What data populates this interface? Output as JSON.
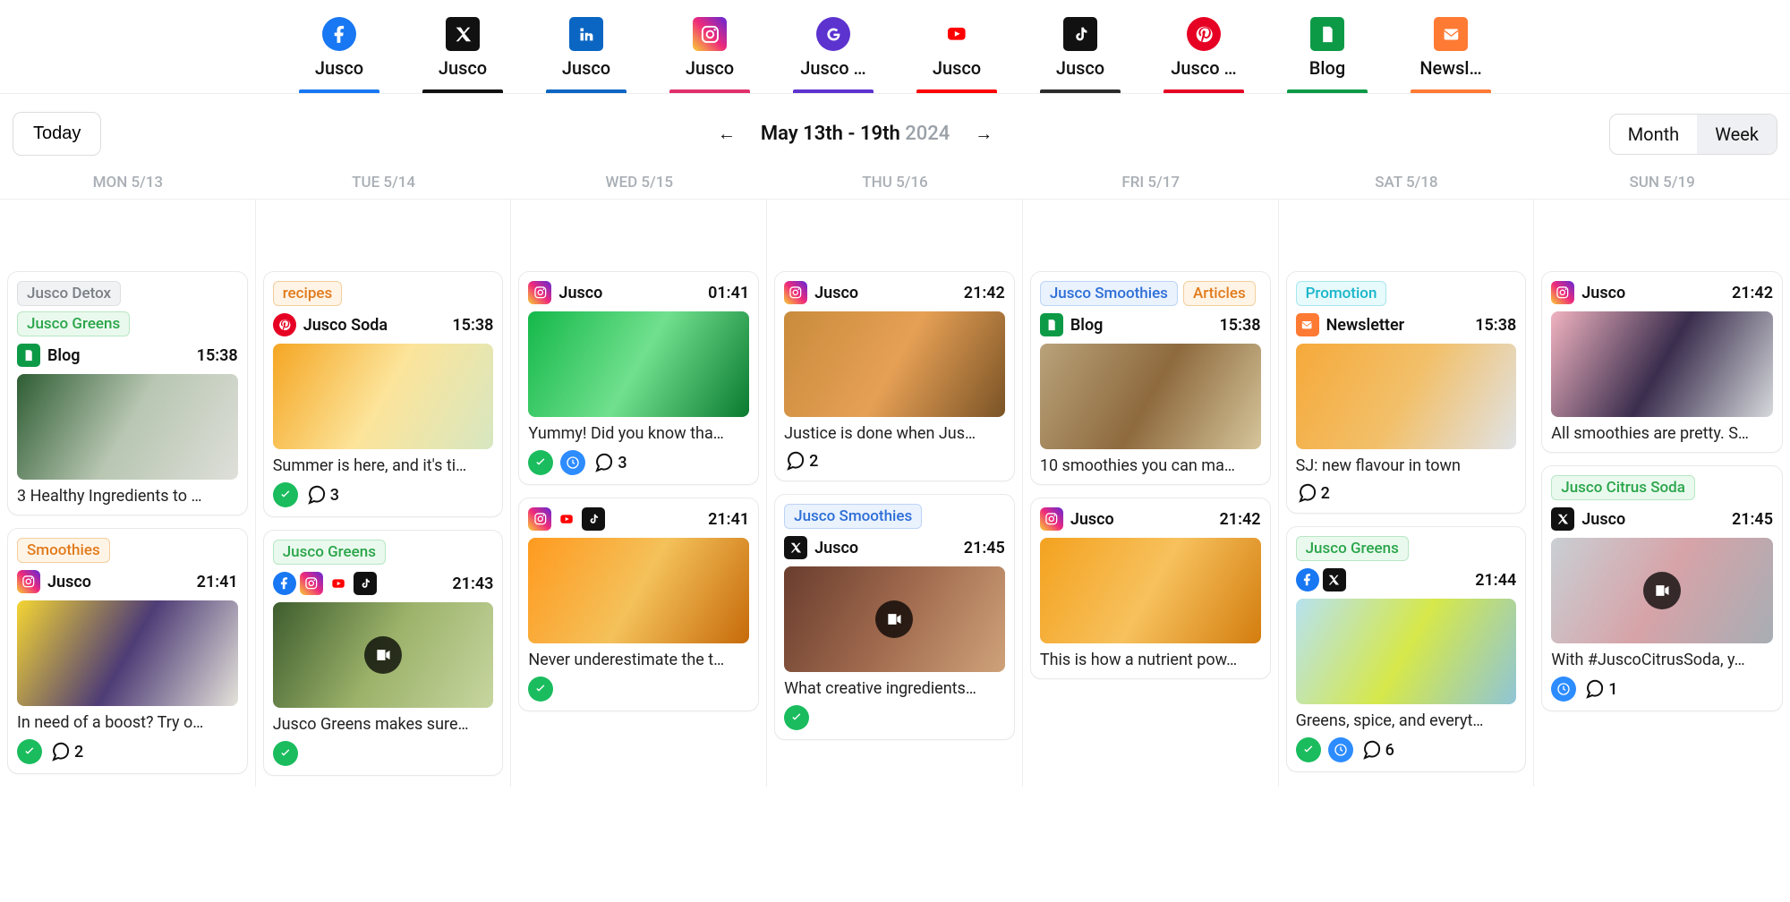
{
  "accounts": [
    {
      "platform": "facebook",
      "label": "Jusco",
      "color": "#1877f2"
    },
    {
      "platform": "x",
      "label": "Jusco",
      "color": "#111111"
    },
    {
      "platform": "linkedin",
      "label": "Jusco",
      "color": "#0a66c2"
    },
    {
      "platform": "instagram",
      "label": "Jusco",
      "color": "#e1306c"
    },
    {
      "platform": "google",
      "label": "Jusco …",
      "color": "#5c33cf"
    },
    {
      "platform": "youtube",
      "label": "Jusco",
      "color": "#ff0000"
    },
    {
      "platform": "tiktok",
      "label": "Jusco",
      "color": "#2c2c2c"
    },
    {
      "platform": "pinterest",
      "label": "Jusco …",
      "color": "#e60023"
    },
    {
      "platform": "blog",
      "label": "Blog",
      "color": "#0d9a47"
    },
    {
      "platform": "newsletter",
      "label": "Newsl…",
      "color": "#ff7a33"
    }
  ],
  "controls": {
    "today": "Today",
    "range_main": "May 13th - 19th",
    "range_year": "2024",
    "month": "Month",
    "week": "Week"
  },
  "days": [
    {
      "label": "MON 5/13"
    },
    {
      "label": "TUE 5/14"
    },
    {
      "label": "WED 5/15"
    },
    {
      "label": "THU 5/16"
    },
    {
      "label": "FRI 5/17"
    },
    {
      "label": "SAT 5/18"
    },
    {
      "label": "SUN 5/19"
    }
  ],
  "columns": [
    [
      {
        "tags": [
          {
            "text": "Jusco Detox",
            "fg": "#7a7f85",
            "bg": "#f1f2f4",
            "bd": "#dcdfe3"
          },
          {
            "text": "Jusco Greens",
            "fg": "#2aa54a",
            "bg": "#eaf9ee",
            "bd": "#b7e7c3"
          }
        ],
        "platforms": [
          "blog"
        ],
        "channel": "Blog",
        "time": "15:38",
        "thumb": {
          "colors": [
            "#2e5d33",
            "#b8c6b2",
            "#dedfd9"
          ],
          "video": false
        },
        "caption": "3 Healthy Ingredients to …",
        "status": null,
        "clock": false,
        "comments": null
      },
      {
        "tags": [
          {
            "text": "Smoothies",
            "fg": "#e07b1c",
            "bg": "#fff4e6",
            "bd": "#f2cf9e"
          }
        ],
        "platforms": [
          "instagram"
        ],
        "channel": "Jusco",
        "time": "21:41",
        "thumb": {
          "colors": [
            "#f4d533",
            "#4e3c76",
            "#e4e2da"
          ],
          "video": false
        },
        "caption": "In need of a boost? Try o…",
        "status": "green",
        "clock": false,
        "comments": 2
      }
    ],
    [
      {
        "tags": [
          {
            "text": "recipes",
            "fg": "#e07b1c",
            "bg": "#fff4e6",
            "bd": "#f2cf9e"
          }
        ],
        "platforms": [
          "pinterest"
        ],
        "channel": "Jusco Soda",
        "time": "15:38",
        "thumb": {
          "colors": [
            "#f5a623",
            "#fce49a",
            "#d7e7c1"
          ],
          "video": false
        },
        "caption": "Summer is here, and it's ti…",
        "status": "green",
        "clock": false,
        "comments": 3
      },
      {
        "tags": [
          {
            "text": "Jusco Greens",
            "fg": "#2aa54a",
            "bg": "#eaf9ee",
            "bd": "#b7e7c3"
          }
        ],
        "platforms": [
          "facebook",
          "instagram",
          "youtube",
          "tiktok"
        ],
        "channel": "",
        "time": "21:43",
        "thumb": {
          "colors": [
            "#3e5d2e",
            "#9cb26a",
            "#c7d6a0"
          ],
          "video": true
        },
        "caption": "Jusco Greens makes sure…",
        "status": "green",
        "clock": false,
        "comments": null
      }
    ],
    [
      {
        "tags": [],
        "platforms": [
          "instagram"
        ],
        "channel": "Jusco",
        "time": "01:41",
        "thumb": {
          "colors": [
            "#14b84a",
            "#71e08e",
            "#0a7a30"
          ],
          "video": false
        },
        "caption": "Yummy! Did you know tha…",
        "status": "green",
        "clock": true,
        "comments": 3
      },
      {
        "tags": [],
        "platforms": [
          "instagram",
          "youtube",
          "tiktok"
        ],
        "channel": "",
        "time": "21:41",
        "thumb": {
          "colors": [
            "#ff9a1f",
            "#f4c15a",
            "#c66a0a"
          ],
          "video": false
        },
        "caption": "Never underestimate the t…",
        "status": "green",
        "clock": false,
        "comments": null
      }
    ],
    [
      {
        "tags": [],
        "platforms": [
          "instagram"
        ],
        "channel": "Jusco",
        "time": "21:42",
        "thumb": {
          "colors": [
            "#c98b3c",
            "#e6a055",
            "#7a5326"
          ],
          "video": false
        },
        "caption": "Justice is done when Jus…",
        "status": null,
        "clock": false,
        "comments": 2
      },
      {
        "tags": [
          {
            "text": "Jusco Smoothies",
            "fg": "#2d6ed6",
            "bg": "#eaf2fe",
            "bd": "#bcd4f6"
          }
        ],
        "platforms": [
          "x"
        ],
        "channel": "Jusco",
        "time": "21:45",
        "thumb": {
          "colors": [
            "#6a3d2e",
            "#a06a4e",
            "#cfa27a"
          ],
          "video": true
        },
        "caption": "What creative ingredients…",
        "status": "green",
        "clock": false,
        "comments": null
      }
    ],
    [
      {
        "tags": [
          {
            "text": "Jusco Smoothies",
            "fg": "#2d6ed6",
            "bg": "#eaf2fe",
            "bd": "#bcd4f6"
          },
          {
            "text": "Articles",
            "fg": "#e07b1c",
            "bg": "#fff4e6",
            "bd": "#f2cf9e"
          }
        ],
        "platforms": [
          "blog"
        ],
        "channel": "Blog",
        "time": "15:38",
        "thumb": {
          "colors": [
            "#b9a27a",
            "#8e6a3e",
            "#d6c59b"
          ],
          "video": false
        },
        "caption": "10 smoothies you can ma…",
        "status": null,
        "clock": false,
        "comments": null
      },
      {
        "tags": [],
        "platforms": [
          "instagram"
        ],
        "channel": "Jusco",
        "time": "21:42",
        "thumb": {
          "colors": [
            "#f4a21f",
            "#f7c15d",
            "#d37d0e"
          ],
          "video": false
        },
        "caption": "This is how a nutrient pow…",
        "status": null,
        "clock": false,
        "comments": null
      }
    ],
    [
      {
        "tags": [
          {
            "text": "Promotion",
            "fg": "#18b6c9",
            "bg": "#e7fafc",
            "bd": "#a8e7ef"
          }
        ],
        "platforms": [
          "newsletter"
        ],
        "channel": "Newsletter",
        "time": "15:38",
        "thumb": {
          "colors": [
            "#f6a93a",
            "#f2c06a",
            "#e0e3e6"
          ],
          "video": false
        },
        "caption": "SJ: new flavour in town",
        "status": null,
        "clock": false,
        "comments": 2
      },
      {
        "tags": [
          {
            "text": "Jusco Greens",
            "fg": "#2aa54a",
            "bg": "#eaf9ee",
            "bd": "#b7e7c3"
          }
        ],
        "platforms": [
          "facebook",
          "x"
        ],
        "channel": "",
        "time": "21:44",
        "thumb": {
          "colors": [
            "#b7e2f0",
            "#d6e84a",
            "#8fc5d6"
          ],
          "video": false
        },
        "caption": "Greens, spice, and everyt…",
        "status": "green",
        "clock": true,
        "comments": 6
      }
    ],
    [
      {
        "tags": [],
        "platforms": [
          "instagram"
        ],
        "channel": "Jusco",
        "time": "21:42",
        "thumb": {
          "colors": [
            "#f0b3c0",
            "#3a2d4d",
            "#d6d9dc"
          ],
          "video": false
        },
        "caption": "All smoothies are pretty. S…",
        "status": null,
        "clock": false,
        "comments": null
      },
      {
        "tags": [
          {
            "text": "Jusco Citrus Soda",
            "fg": "#2aa54a",
            "bg": "#eaf9ee",
            "bd": "#b7e7c3"
          }
        ],
        "platforms": [
          "x"
        ],
        "channel": "Jusco",
        "time": "21:45",
        "thumb": {
          "colors": [
            "#c9cfd4",
            "#d6a3a8",
            "#a7aeb4"
          ],
          "video": true
        },
        "caption": "With #JuscoCitrusSoda, y…",
        "status": null,
        "clock": true,
        "comments": 1
      }
    ]
  ]
}
